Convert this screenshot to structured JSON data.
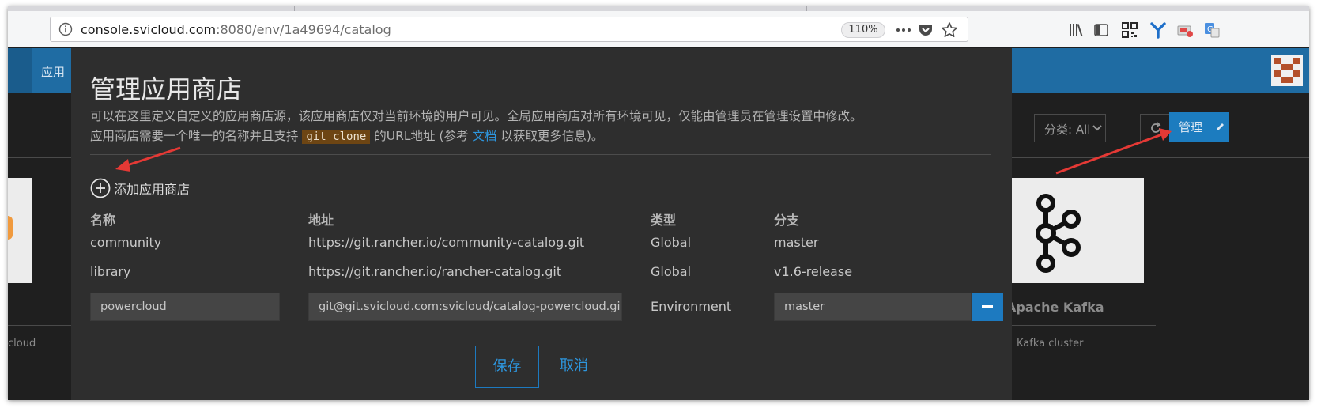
{
  "browser": {
    "url_host": "console.svicloud.com",
    "url_rest": ":8080/env/1a49694/catalog",
    "url_prefix": "",
    "zoom": "110%"
  },
  "app": {
    "nav_label": "应用",
    "filter_label": "分类: All",
    "manage_label": "管理",
    "card_left_desc": "cloud",
    "card_right_title": "Apache Kafka",
    "card_right_desc": "Kafka cluster"
  },
  "modal": {
    "title": "管理应用商店",
    "desc_line1": "可以在这里定义自定义的应用商店源，该应用商店仅对当前环境的用户可见。全局应用商店对所有环境可见，仅能由管理员在管理设置中修改。",
    "desc_line2_a": "应用商店需要一个唯一的名称并且支持",
    "desc_code": "git clone",
    "desc_line2_b": "的URL地址 (参考",
    "desc_link": "文档",
    "desc_line2_c": "以获取更多信息)。",
    "add_label": "添加应用商店",
    "columns": {
      "name": "名称",
      "url": "地址",
      "type": "类型",
      "branch": "分支"
    },
    "rows": [
      {
        "name": "community",
        "url": "https://git.rancher.io/community-catalog.git",
        "type": "Global",
        "branch": "master"
      },
      {
        "name": "library",
        "url": "https://git.rancher.io/rancher-catalog.git",
        "type": "Global",
        "branch": "v1.6-release"
      }
    ],
    "new_row": {
      "name": "powercloud",
      "url": "git@git.svicloud.com:svicloud/catalog-powercloud.git",
      "type": "Environment",
      "branch": "master"
    },
    "save_label": "保存",
    "cancel_label": "取消"
  },
  "colors": {
    "accent": "#1d7ac0",
    "link": "#2d96de",
    "annotation_arrow": "#e53935",
    "modal_bg": "#2e2e2e"
  }
}
